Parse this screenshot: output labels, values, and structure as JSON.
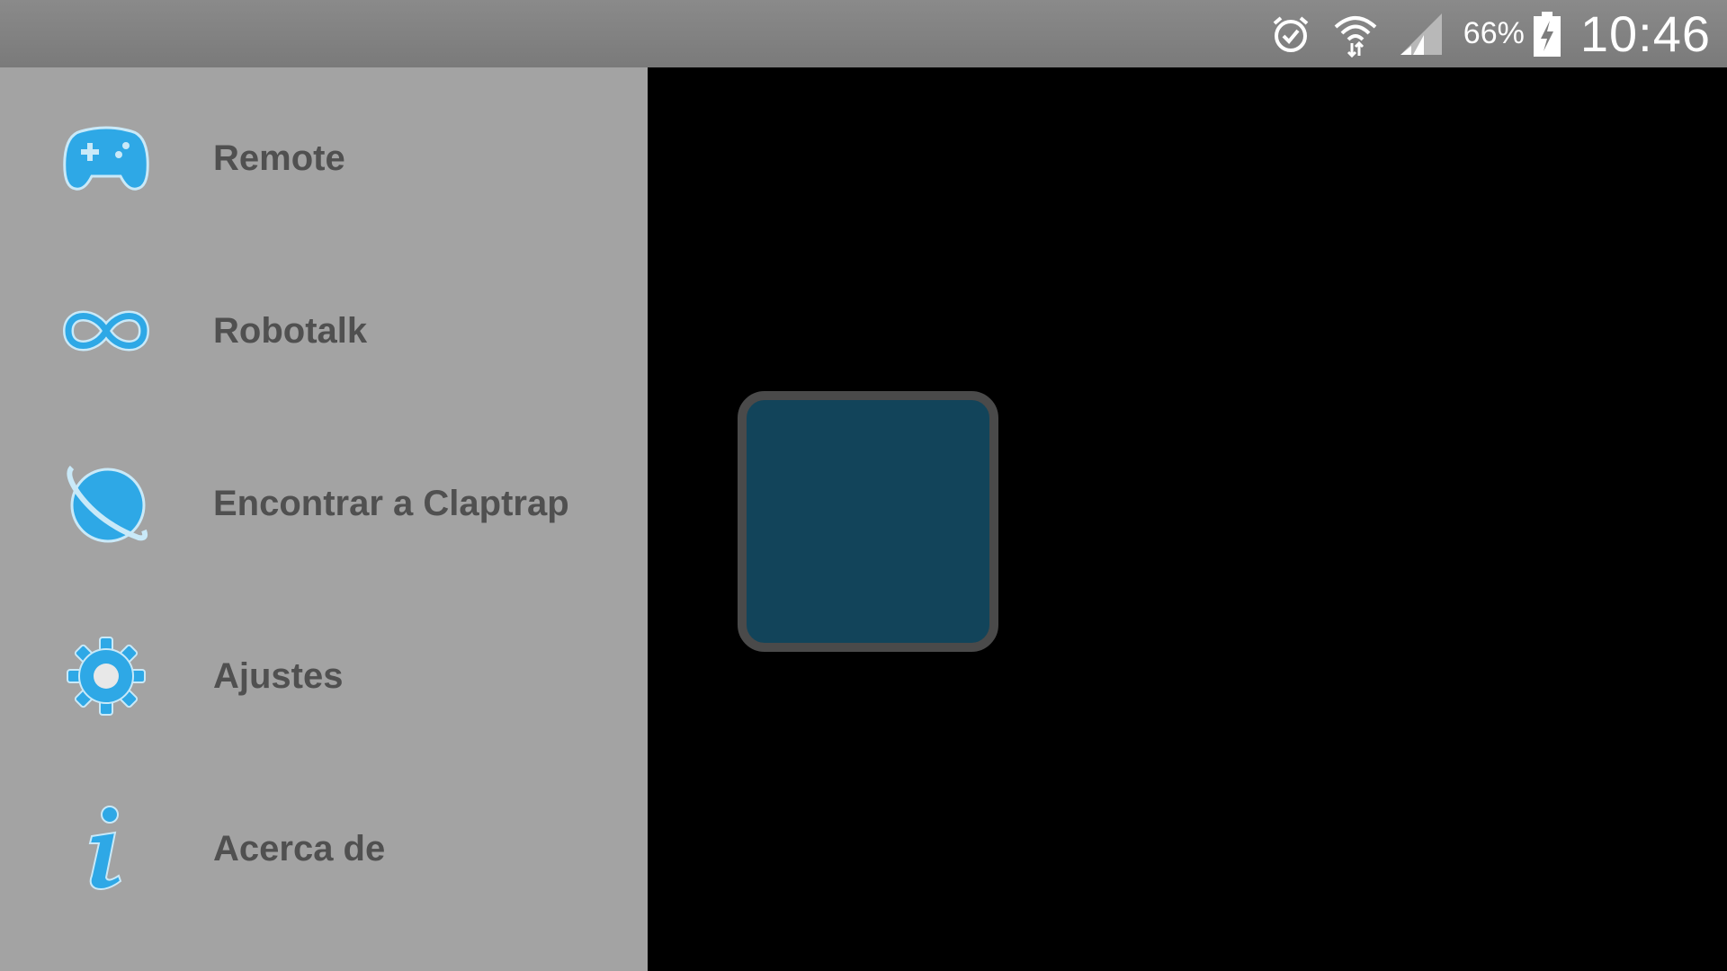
{
  "status_bar": {
    "icons": [
      "alarm-icon",
      "wifi-icon",
      "signal-icon",
      "battery-charging-icon"
    ],
    "battery_percent": "66%",
    "time": "10:46"
  },
  "drawer": {
    "items": [
      {
        "label": "Remote",
        "icon": "gamepad-icon"
      },
      {
        "label": "Robotalk",
        "icon": "infinity-icon"
      },
      {
        "label": "Encontrar a Claptrap",
        "icon": "planet-icon"
      },
      {
        "label": "Ajustes",
        "icon": "gear-icon"
      },
      {
        "label": "Acerca de",
        "icon": "info-icon"
      }
    ]
  },
  "colors": {
    "icon_blue": "#2ea8e6",
    "drawer_bg": "#a3a3a3",
    "label_text": "#505050",
    "square_fill": "#12445a"
  }
}
